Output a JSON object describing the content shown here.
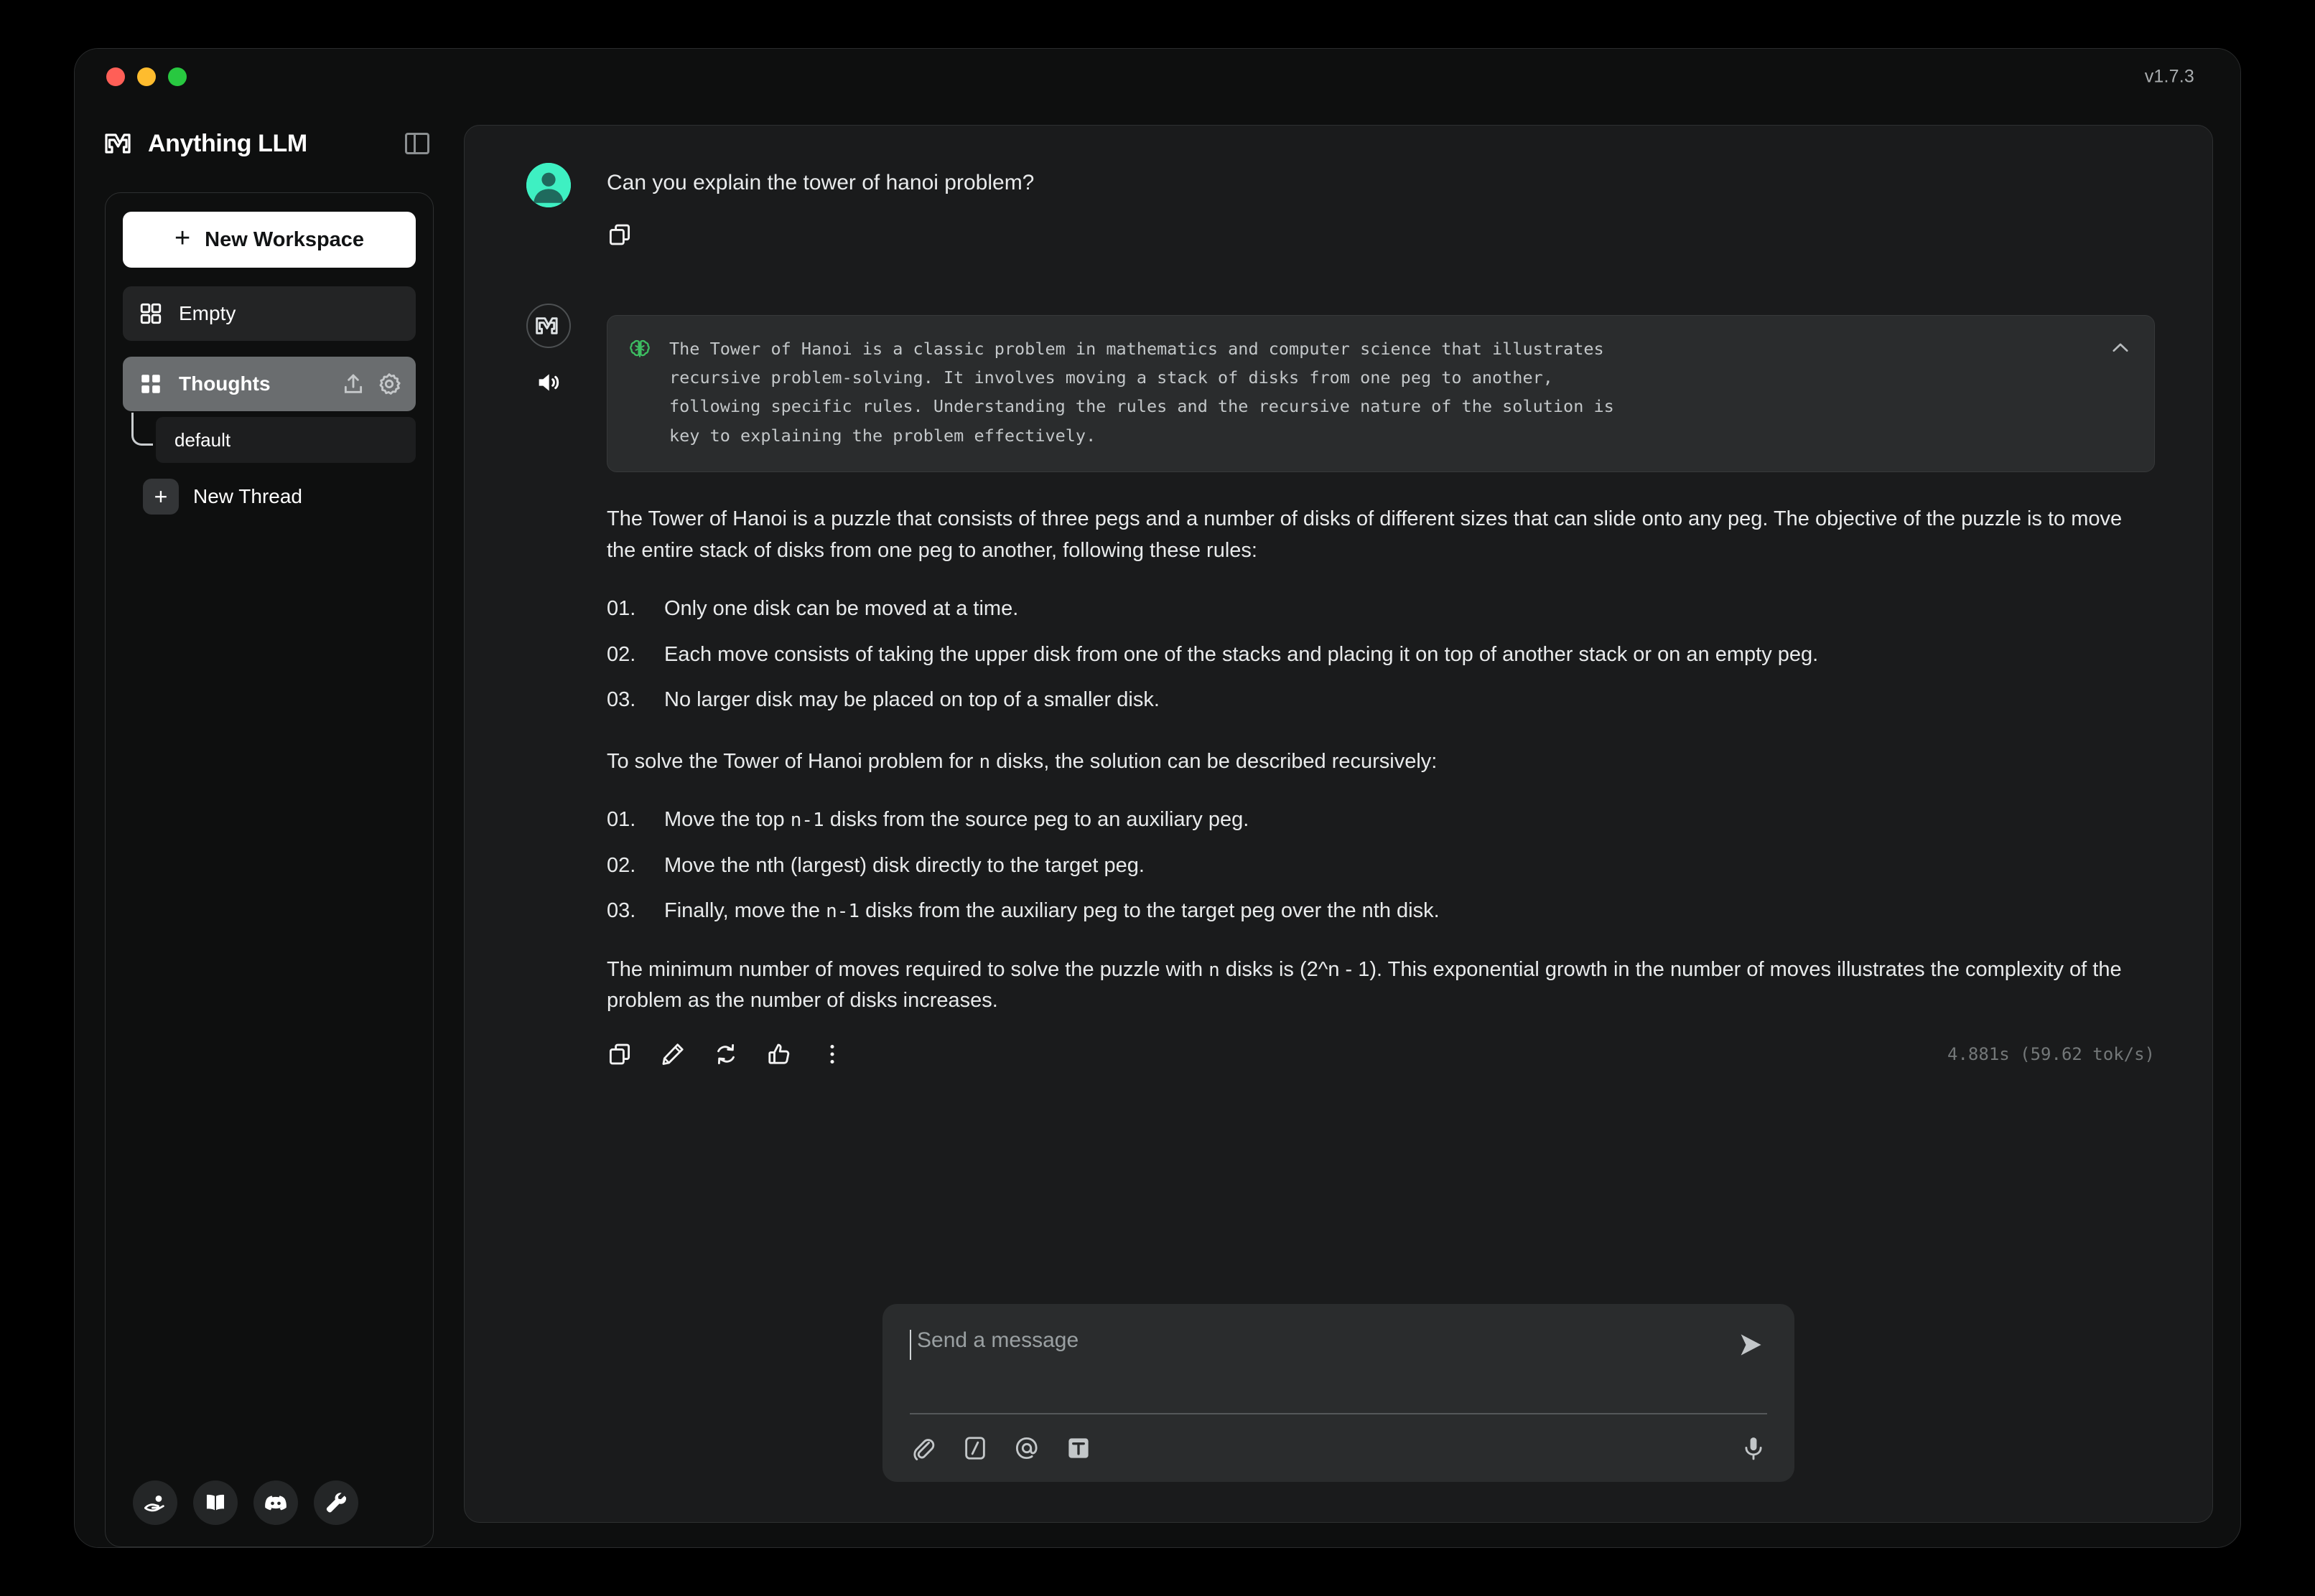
{
  "window": {
    "version": "v1.7.3",
    "traffic_lights": [
      "close",
      "minimize",
      "maximize"
    ]
  },
  "sidebar": {
    "brand": "Anything LLM",
    "panel_toggle_icon": "sidebar-toggle-icon",
    "new_workspace_label": "New Workspace",
    "workspaces": [
      {
        "label": "Empty",
        "icon": "grid-icon",
        "active": false
      },
      {
        "label": "Thoughts",
        "icon": "grid-icon",
        "active": true,
        "actions": [
          "upload-icon",
          "gear-icon"
        ]
      }
    ],
    "threads": [
      {
        "label": "default"
      }
    ],
    "new_thread_label": "New Thread",
    "footer_icons": [
      "hand-coin-icon",
      "book-icon",
      "discord-icon",
      "wrench-icon"
    ]
  },
  "chat": {
    "user_message": {
      "author_icon": "user-avatar",
      "text": "Can you explain the tower of hanoi problem?",
      "actions": [
        "copy-icon"
      ]
    },
    "assistant_message": {
      "author_icon": "anythingllm-logo-avatar",
      "tts_icon": "speaker-icon",
      "thinking": {
        "icon": "brain-icon",
        "collapse_icon": "chevron-up-icon",
        "text": "The Tower of Hanoi is a classic problem in mathematics and computer science that illustrates\nrecursive problem-solving. It involves moving a stack of disks from one peg to another,\nfollowing specific rules. Understanding the rules and the recursive nature of the solution is\nkey to explaining the problem effectively."
      },
      "intro_paragraph": "The Tower of Hanoi is a puzzle that consists of three pegs and a number of disks of different sizes that can slide onto any peg. The objective of the puzzle is to move the entire stack of disks from one peg to another, following these rules:",
      "rules": [
        {
          "num": "01.",
          "text": "Only one disk can be moved at a time."
        },
        {
          "num": "02.",
          "text": "Each move consists of taking the upper disk from one of the stacks and placing it on top of another stack or on an empty peg."
        },
        {
          "num": "03.",
          "text": "No larger disk may be placed on top of a smaller disk."
        }
      ],
      "solve_paragraph_pre": "To solve the Tower of Hanoi problem for ",
      "solve_paragraph_code": "n",
      "solve_paragraph_post": " disks, the solution can be described recursively:",
      "steps": [
        {
          "num": "01.",
          "pre": "Move the top ",
          "code": "n-1",
          "post": " disks from the source peg to an auxiliary peg."
        },
        {
          "num": "02.",
          "pre": "Move the nth (largest) disk directly to the target peg.",
          "code": "",
          "post": ""
        },
        {
          "num": "03.",
          "pre": "Finally, move the ",
          "code": "n-1",
          "post": " disks from the auxiliary peg to the target peg over the nth disk."
        }
      ],
      "final_pre": "The minimum number of moves required to solve the puzzle with ",
      "final_code": "n",
      "final_post": " disks is (2^n - 1). This exponential growth in the number of moves illustrates the complexity of the problem as the number of disks increases.",
      "actions": [
        "copy-icon",
        "edit-icon",
        "regenerate-icon",
        "thumbs-up-icon",
        "more-vertical-icon"
      ],
      "timing": "4.881s (59.62 tok/s)"
    }
  },
  "composer": {
    "placeholder": "Send a message",
    "send_icon": "send-icon",
    "left_icons": [
      "attachment-icon",
      "slash-command-icon",
      "mention-icon",
      "text-size-icon"
    ],
    "right_icons": [
      "microphone-icon"
    ]
  },
  "colors": {
    "accent_white": "#ffffff",
    "avatar_teal": "#3ef0c2",
    "brain_green": "#3dbf62",
    "active_workspace": "#6a6d6f",
    "panel_bg": "#1a1b1c",
    "app_bg": "#0e0f0f"
  }
}
